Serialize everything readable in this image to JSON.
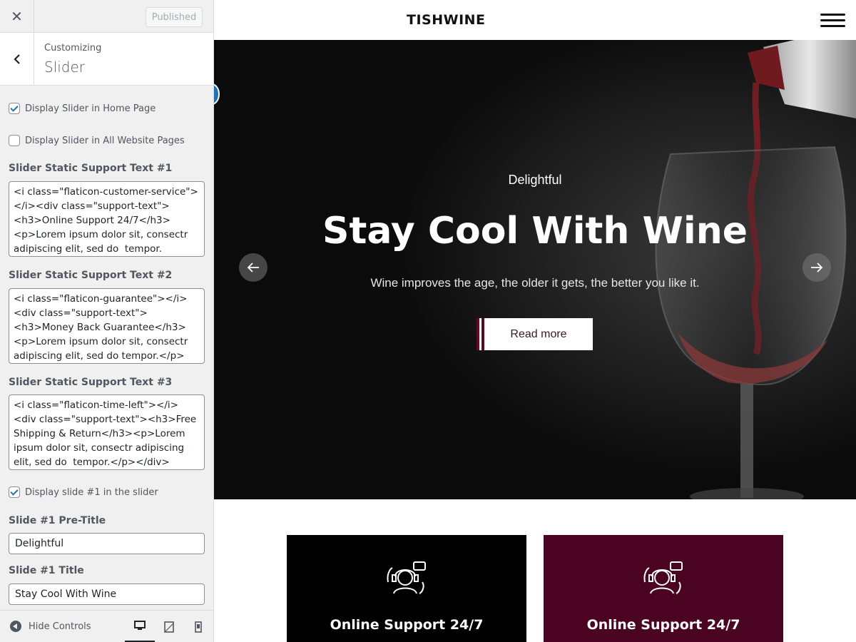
{
  "customizer": {
    "publish_label": "Published",
    "breadcrumb": "Customizing",
    "section_title": "Slider",
    "options": {
      "display_home": {
        "label": "Display Slider in Home Page",
        "checked": true
      },
      "display_all": {
        "label": "Display Slider in All Website Pages",
        "checked": false
      },
      "support_1": {
        "label": "Slider Static Support Text #1",
        "value": "<i class=\"flaticon-customer-service\"></i><div class=\"support-text\"><h3>Online Support 24/7</h3><p>Lorem ipsum dolor sit, consectr adipiscing elit, sed do  tempor."
      },
      "support_2": {
        "label": "Slider Static Support Text #2",
        "value": "<i class=\"flaticon-guarantee\"></i><div class=\"support-text\"><h3>Money Back Guarantee</h3><p>Lorem ipsum dolor sit, consectr adipiscing elit, sed do tempor.</p></div>"
      },
      "support_3": {
        "label": "Slider Static Support Text #3",
        "value": "<i class=\"flaticon-time-left\"></i><div class=\"support-text\"><h3>Free Shipping & Return</h3><p>Lorem ipsum dolor sit, consectr adipiscing elit, sed do  tempor.</p></div>"
      },
      "display_slide_1": {
        "label": "Display slide #1 in the slider",
        "checked": true
      },
      "slide_1_pretitle": {
        "label": "Slide #1 Pre-Title",
        "value": "Delightful"
      },
      "slide_1_title": {
        "label": "Slide #1 Title",
        "value": "Stay Cool With Wine"
      }
    },
    "footer": {
      "hide_label": "Hide Controls",
      "active_device": "desktop"
    }
  },
  "preview": {
    "site_title": "TISHWINE",
    "slide": {
      "pretitle": "Delightful",
      "title": "Stay Cool With Wine",
      "subtitle": "Wine improves the age, the older it gets, the better you like it.",
      "button": "Read more"
    },
    "cards": [
      {
        "title": "Online Support 24/7",
        "bg": "#000000"
      },
      {
        "title": "Online Support 24/7",
        "bg": "#4a0421"
      }
    ],
    "colors": {
      "accent": "#5b0a22",
      "wp_blue": "#2271b1"
    }
  }
}
